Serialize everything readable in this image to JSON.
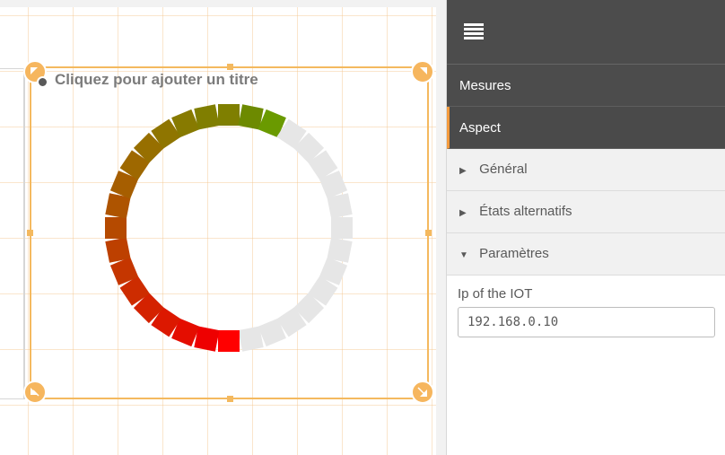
{
  "object": {
    "title_placeholder": "Cliquez pour ajouter un titre"
  },
  "ring": {
    "total_segments": 32,
    "segments": [
      {
        "color": "#7f7f00",
        "state": "on"
      },
      {
        "color": "#6d8a00",
        "state": "on"
      },
      {
        "color": "#6a9a00",
        "state": "on"
      },
      {
        "color": "#e6e6e6",
        "state": "off"
      },
      {
        "color": "#e6e6e6",
        "state": "off"
      },
      {
        "color": "#e6e6e6",
        "state": "off"
      },
      {
        "color": "#e6e6e6",
        "state": "off"
      },
      {
        "color": "#e6e6e6",
        "state": "off"
      },
      {
        "color": "#e6e6e6",
        "state": "off"
      },
      {
        "color": "#e6e6e6",
        "state": "off"
      },
      {
        "color": "#e6e6e6",
        "state": "off"
      },
      {
        "color": "#e6e6e6",
        "state": "off"
      },
      {
        "color": "#e6e6e6",
        "state": "off"
      },
      {
        "color": "#e6e6e6",
        "state": "off"
      },
      {
        "color": "#e6e6e6",
        "state": "off"
      },
      {
        "color": "#e6e6e6",
        "state": "off"
      },
      {
        "color": "#ff0000",
        "state": "on"
      },
      {
        "color": "#ee0000",
        "state": "on"
      },
      {
        "color": "#e40d00",
        "state": "on"
      },
      {
        "color": "#dc1800",
        "state": "on"
      },
      {
        "color": "#d42200",
        "state": "on"
      },
      {
        "color": "#cd2c00",
        "state": "on"
      },
      {
        "color": "#c53600",
        "state": "on"
      },
      {
        "color": "#bd4000",
        "state": "on"
      },
      {
        "color": "#b54a00",
        "state": "on"
      },
      {
        "color": "#ae5400",
        "state": "on"
      },
      {
        "color": "#a65e00",
        "state": "on"
      },
      {
        "color": "#9e6800",
        "state": "on"
      },
      {
        "color": "#976f00",
        "state": "on"
      },
      {
        "color": "#8f7500",
        "state": "on"
      },
      {
        "color": "#877a00",
        "state": "on"
      },
      {
        "color": "#807e00",
        "state": "on"
      }
    ]
  },
  "panel": {
    "tabs": [
      {
        "label": "Mesures",
        "active": false
      },
      {
        "label": "Aspect",
        "active": true
      }
    ],
    "sections": [
      {
        "label": "Général",
        "expanded": false
      },
      {
        "label": "États alternatifs",
        "expanded": false
      },
      {
        "label": "Paramètres",
        "expanded": true
      }
    ],
    "ip_field": {
      "label": "Ip of the IOT",
      "value": "192.168.0.10"
    }
  },
  "colors": {
    "accent": "#f39a3d",
    "selection": "#f4b95f",
    "panel_dark": "#4c4c4c"
  }
}
